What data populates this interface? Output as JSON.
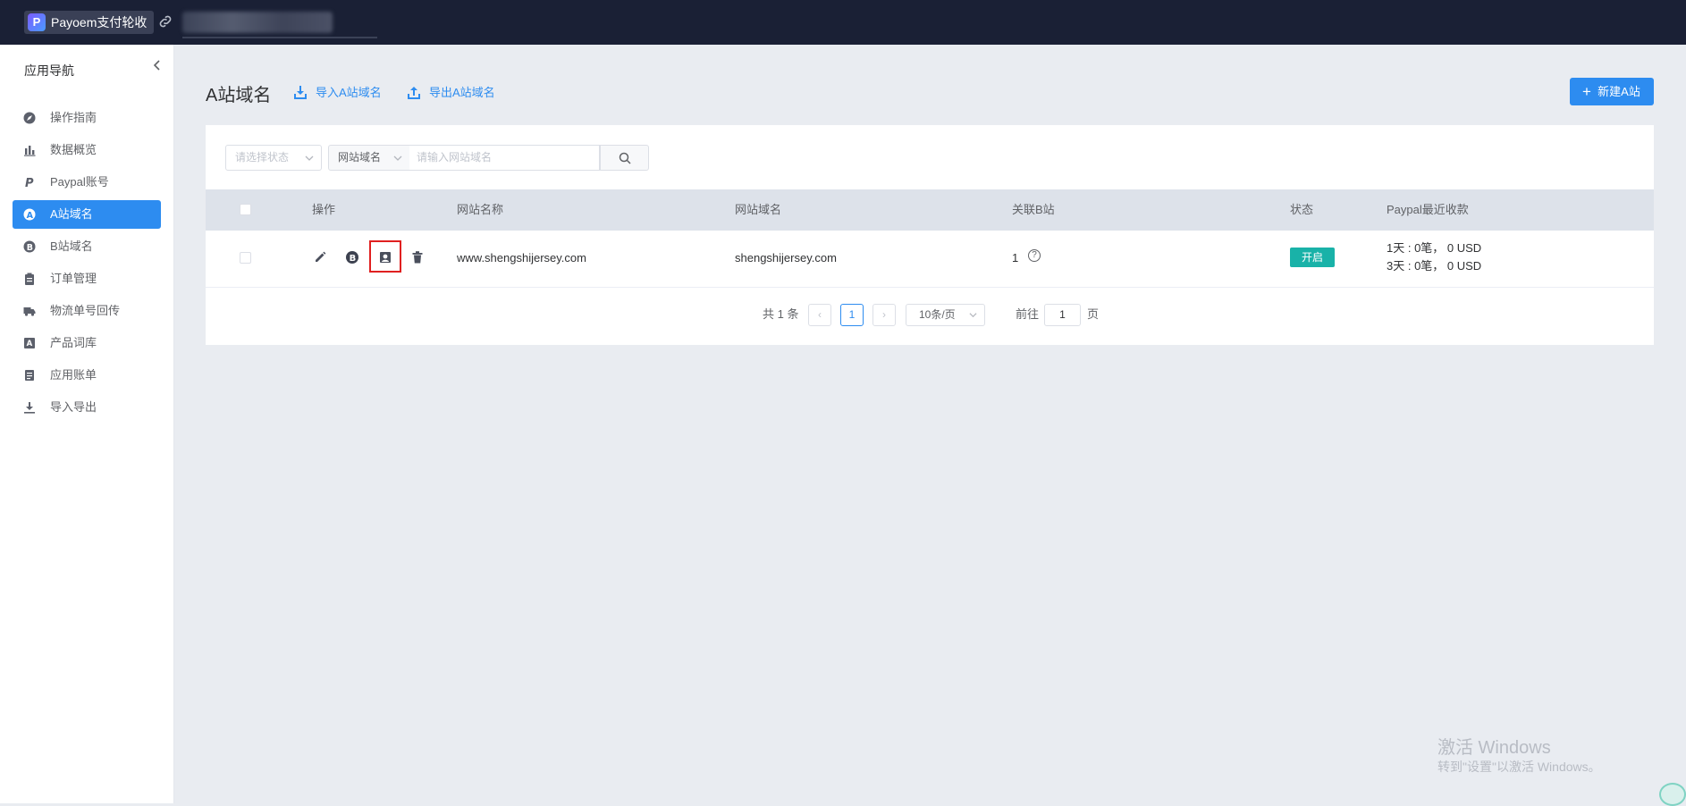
{
  "app": {
    "brand": "Payoem支付轮收",
    "logo_letter": "P"
  },
  "sidebar": {
    "title": "应用导航",
    "items": [
      {
        "label": "操作指南",
        "icon": "compass-icon",
        "active": false
      },
      {
        "label": "数据概览",
        "icon": "bar-chart-icon",
        "active": false
      },
      {
        "label": "Paypal账号",
        "icon": "paypal-icon",
        "active": false
      },
      {
        "label": "A站域名",
        "icon": "letter-a-icon",
        "active": true
      },
      {
        "label": "B站域名",
        "icon": "letter-b-icon",
        "active": false
      },
      {
        "label": "订单管理",
        "icon": "clipboard-icon",
        "active": false
      },
      {
        "label": "物流单号回传",
        "icon": "truck-icon",
        "active": false
      },
      {
        "label": "产品词库",
        "icon": "dictionary-icon",
        "active": false
      },
      {
        "label": "应用账单",
        "icon": "bill-icon",
        "active": false
      },
      {
        "label": "导入导出",
        "icon": "download-icon",
        "active": false
      }
    ]
  },
  "header": {
    "title": "A站域名",
    "import_label": "导入A站域名",
    "export_label": "导出A站域名",
    "new_label": "新建A站"
  },
  "filters": {
    "status_placeholder": "请选择状态",
    "field_select": "网站域名",
    "search_placeholder": "请输入网站域名"
  },
  "table": {
    "columns": [
      "操作",
      "网站名称",
      "网站域名",
      "关联B站",
      "状态",
      "Paypal最近收款"
    ],
    "rows": [
      {
        "site_name": "www.shengshijersey.com",
        "domain": "shengshijersey.com",
        "linked_b": "1",
        "help": "?",
        "status": "开启",
        "recent_1": "1天 : 0笔， 0 USD",
        "recent_3": "3天 : 0笔， 0 USD",
        "b_badge": "B"
      }
    ]
  },
  "pagination": {
    "total": "共 1 条",
    "current": "1",
    "page_size": "10条/页",
    "goto_label": "前往",
    "goto_value": "1",
    "page_unit": "页",
    "prev": "‹",
    "next": "›"
  },
  "watermark": {
    "line1": "激活 Windows",
    "line2": "转到\"设置\"以激活 Windows。"
  },
  "colors": {
    "accent": "#2d8cf0",
    "topbar": "#1a2035",
    "status_on": "#19b2a8",
    "highlight": "#e02020"
  }
}
